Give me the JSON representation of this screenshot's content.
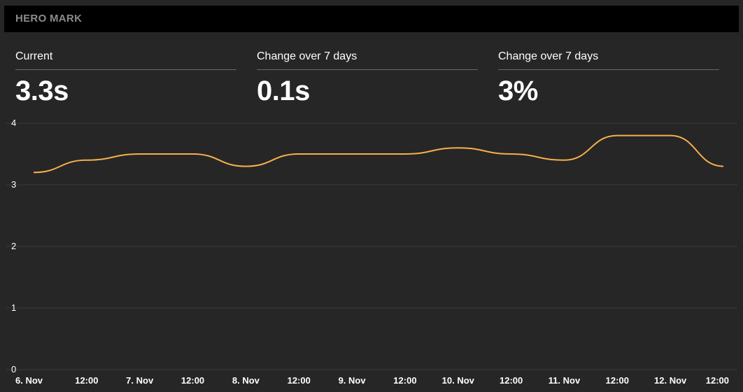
{
  "header": {
    "title": "HERO MARK"
  },
  "metrics": [
    {
      "label": "Current",
      "value": "3.3s"
    },
    {
      "label": "Change over 7 days",
      "value": "0.1s"
    },
    {
      "label": "Change over 7 days",
      "value": "3%"
    }
  ],
  "chart_data": {
    "type": "line",
    "title": "",
    "xlabel": "",
    "ylabel": "",
    "ylim": [
      0,
      4
    ],
    "yticks": [
      "0",
      "1",
      "2",
      "3",
      "4"
    ],
    "xticks": [
      "6. Nov",
      "12:00",
      "7. Nov",
      "12:00",
      "8. Nov",
      "12:00",
      "9. Nov",
      "12:00",
      "10. Nov",
      "12:00",
      "11. Nov",
      "12:00",
      "12. Nov",
      "12:00"
    ],
    "grid": true,
    "line_color": "#f5b04c",
    "series": [
      {
        "x": [
          "2016-11-06 00:00",
          "2016-11-06 12:00",
          "2016-11-07 00:00",
          "2016-11-07 12:00",
          "2016-11-08 00:00",
          "2016-11-08 12:00",
          "2016-11-09 00:00",
          "2016-11-09 12:00",
          "2016-11-10 00:00",
          "2016-11-10 12:00",
          "2016-11-11 00:00",
          "2016-11-11 12:00",
          "2016-11-12 00:00",
          "2016-11-12 12:00"
        ],
        "values": [
          3.2,
          3.4,
          3.5,
          3.5,
          3.3,
          3.5,
          3.5,
          3.5,
          3.6,
          3.5,
          3.4,
          3.8,
          3.8,
          3.3
        ]
      }
    ]
  }
}
